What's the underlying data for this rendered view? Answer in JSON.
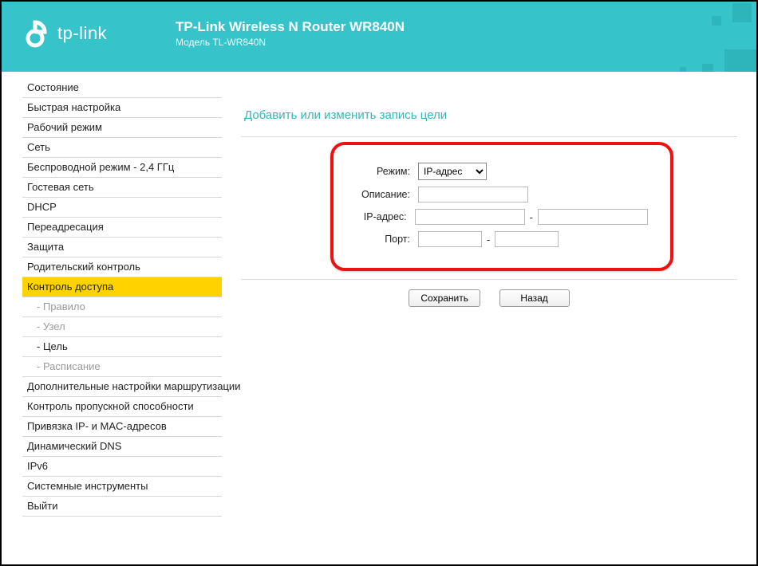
{
  "header": {
    "brand": "tp-link",
    "title": "TP-Link Wireless N Router WR840N",
    "subtitle": "Модель TL-WR840N"
  },
  "sidebar": {
    "items": [
      {
        "label": "Состояние"
      },
      {
        "label": "Быстрая настройка"
      },
      {
        "label": "Рабочий режим"
      },
      {
        "label": "Сеть"
      },
      {
        "label": "Беспроводной режим - 2,4 ГГц"
      },
      {
        "label": "Гостевая сеть"
      },
      {
        "label": "DHCP"
      },
      {
        "label": "Переадресация"
      },
      {
        "label": "Защита"
      },
      {
        "label": "Родительский контроль"
      },
      {
        "label": "Контроль доступа",
        "selected": true
      },
      {
        "label": "- Правило",
        "sub": true
      },
      {
        "label": "- Узел",
        "sub": true
      },
      {
        "label": "- Цель",
        "sub": true,
        "active": true
      },
      {
        "label": "- Расписание",
        "sub": true
      },
      {
        "label": "Дополнительные настройки маршрутизации"
      },
      {
        "label": "Контроль пропускной способности"
      },
      {
        "label": "Привязка IP- и MAC-адресов"
      },
      {
        "label": "Динамический DNS"
      },
      {
        "label": "IPv6"
      },
      {
        "label": "Системные инструменты"
      },
      {
        "label": "Выйти"
      }
    ]
  },
  "page": {
    "title": "Добавить или изменить запись цели",
    "form": {
      "mode_label": "Режим:",
      "mode_value": "IP-адрес",
      "description_label": "Описание:",
      "description_value": "",
      "ip_label": "IP-адрес:",
      "ip_from": "",
      "ip_to": "",
      "port_label": "Порт:",
      "port_from": "",
      "port_to": ""
    },
    "buttons": {
      "save": "Сохранить",
      "back": "Назад"
    }
  }
}
